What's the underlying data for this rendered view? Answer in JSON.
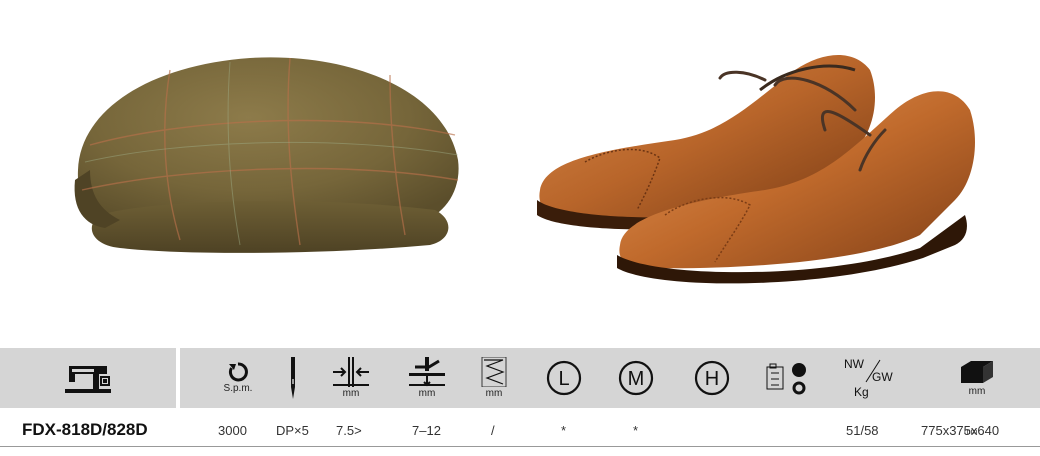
{
  "header": {
    "speed_unit": "S.p.m.",
    "stitch_unit": "mm",
    "lift_unit": "mm",
    "feed_unit": "mm",
    "hook_l": "L",
    "hook_m": "M",
    "hook_h": "H",
    "weight_top": "NW",
    "weight_mid": "GW",
    "weight_bottom": "Kg",
    "size_unit": "mm"
  },
  "row": {
    "model": "FDX-818D/828D",
    "speed": "3000",
    "needle": "DP×5",
    "stitch_length": "7.5>",
    "presser_lift": "7–12",
    "feed": "/",
    "hook_l": "*",
    "hook_m": "*",
    "weight": "51/58",
    "size": "775x375x640",
    "size_unit": "mm"
  },
  "colors": {
    "header_bg": "#d5d5d5",
    "cap_tweed": "#7a6a3e",
    "shoe_leather": "#b8652a"
  },
  "icons": {
    "machine": "sewing-machine-icon",
    "speed": "rotation-icon",
    "needle": "needle-icon",
    "stitch": "stitch-length-icon",
    "lift": "presser-foot-lift-icon",
    "feed": "feed-icon",
    "hook_l": "circle-l-icon",
    "hook_m": "circle-m-icon",
    "hook_h": "circle-h-icon",
    "lubrication": "lubrication-icon",
    "weight": "weight-icon",
    "size": "box-size-icon"
  }
}
